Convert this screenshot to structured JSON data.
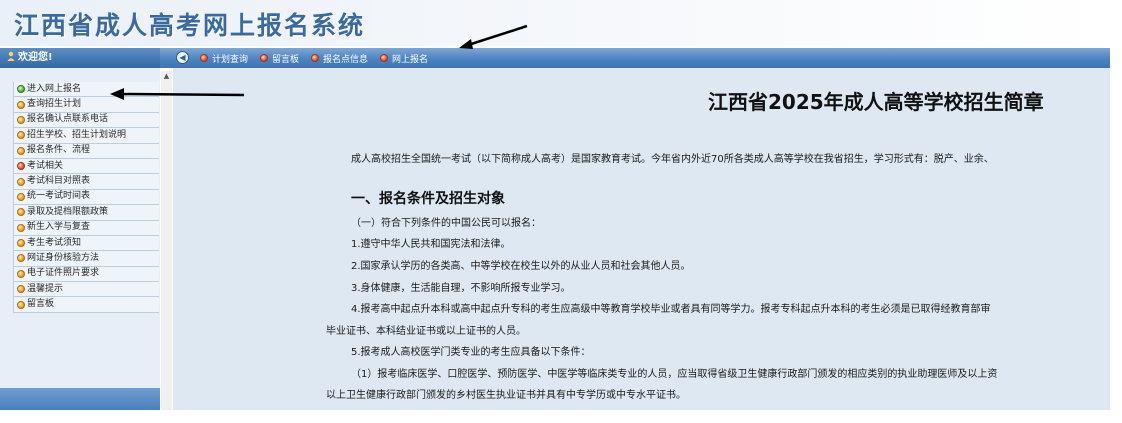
{
  "header": {
    "site_title": "江西省成人高考网上报名系统"
  },
  "navbar": {
    "welcome": "欢迎您!",
    "collapse_icon": "left-arrow-circle-icon",
    "links": [
      {
        "label": "计划查询"
      },
      {
        "label": "留言板"
      },
      {
        "label": "报名点信息"
      },
      {
        "label": "网上报名"
      }
    ]
  },
  "sidebar": {
    "items": [
      {
        "label": "进入网上报名",
        "icon": "green"
      },
      {
        "label": "查询招生计划",
        "icon": "orange"
      },
      {
        "label": "报名确认点联系电话",
        "icon": "orange"
      },
      {
        "label": "招生学校、招生计划说明",
        "icon": "orange"
      },
      {
        "label": "报名条件、流程",
        "icon": "orange"
      },
      {
        "label": "考试相关",
        "icon": "red"
      },
      {
        "label": "考试科目对照表",
        "icon": "orange"
      },
      {
        "label": "统一考试时间表",
        "icon": "orange"
      },
      {
        "label": "录取及提档限额政策",
        "icon": "orange"
      },
      {
        "label": "新生入学与复查",
        "icon": "orange"
      },
      {
        "label": "考生考试须知",
        "icon": "orange"
      },
      {
        "label": "网证身份核验方法",
        "icon": "orange"
      },
      {
        "label": "电子证件照片要求",
        "icon": "orange"
      },
      {
        "label": "温馨提示",
        "icon": "orange"
      },
      {
        "label": "留言板",
        "icon": "orange"
      }
    ]
  },
  "content": {
    "title": "江西省2025年成人高等学校招生简章",
    "intro": "成人高校招生全国统一考试（以下简称成人高考）是国家教育考试。今年省内外近70所各类成人高等学校在我省招生，学习形式有：脱产、业余、",
    "section1_heading": "一、报名条件及招生对象",
    "lines": [
      "（一）符合下列条件的中国公民可以报名：",
      "1.遵守中华人民共和国宪法和法律。",
      "2.国家承认学历的各类高、中等学校在校生以外的从业人员和社会其他人员。",
      "3.身体健康，生活能自理，不影响所报专业学习。",
      "4.报考高中起点升本科或高中起点升专科的考生应高级中等教育学校毕业或者具有同等学力。报考专科起点升本科的考生必须是已取得经教育部审",
      "毕业证书、本科结业证书或以上证书的人员。",
      "5.报考成人高校医学门类专业的考生应具备以下条件：",
      "（1）报考临床医学、口腔医学、预防医学、中医学等临床类专业的人员，应当取得省级卫生健康行政部门颁发的相应类别的执业助理医师及以上资",
      "以上卫生健康行政部门颁发的乡村医生执业证书并具有中专学历或中专水平证书。"
    ]
  }
}
